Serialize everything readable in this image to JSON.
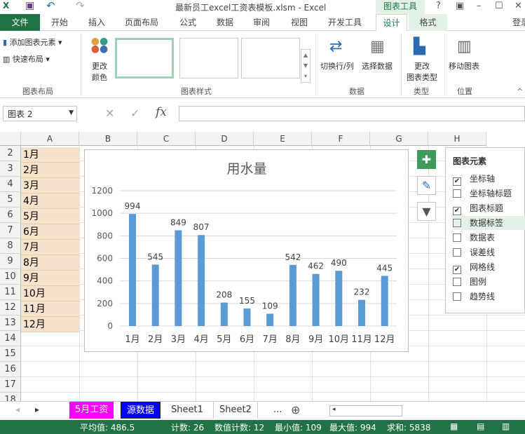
{
  "titlebar": {
    "title": "最新员工excel工资表模板.xlsm - Excel",
    "context_tab": "图表工具",
    "help": "?"
  },
  "tabs": [
    "文件",
    "开始",
    "插入",
    "页面布局",
    "公式",
    "数据",
    "审阅",
    "视图",
    "开发工具",
    "设计",
    "格式"
  ],
  "login": "登录",
  "ribbon": {
    "add_element": "添加图表元素",
    "quick_layout": "快速布局",
    "change_color_1": "更改",
    "change_color_2": "颜色",
    "switch_rowcol": "切换行/列",
    "select_data": "选择数据",
    "change_type_1": "更改",
    "change_type_2": "图表类型",
    "move_chart": "移动图表",
    "groups": [
      "图表布局",
      "图表样式",
      "数据",
      "类型",
      "位置"
    ]
  },
  "formula_bar": {
    "name_box": "图表 2",
    "fx": "fx",
    "value": ""
  },
  "columns": [
    "A",
    "B",
    "C",
    "D",
    "E",
    "F",
    "G",
    "H"
  ],
  "rows": [
    "2",
    "3",
    "4",
    "5",
    "6",
    "7",
    "8",
    "9",
    "10",
    "11",
    "12",
    "13",
    "14",
    "15",
    "16",
    "17",
    "18"
  ],
  "cells_A": [
    "1月",
    "2月",
    "3月",
    "4月",
    "5月",
    "6月",
    "7月",
    "8月",
    "9月",
    "10月",
    "11月",
    "12月"
  ],
  "chart_data": {
    "type": "bar",
    "title": "用水量",
    "categories": [
      "1月",
      "2月",
      "3月",
      "4月",
      "5月",
      "6月",
      "7月",
      "8月",
      "9月",
      "10月",
      "11月",
      "12月"
    ],
    "values": [
      994,
      545,
      849,
      807,
      208,
      155,
      109,
      542,
      462,
      490,
      232,
      445
    ],
    "yticks": [
      "0",
      "200",
      "400",
      "600",
      "800",
      "1000",
      "1200"
    ],
    "ylim": [
      0,
      1200
    ],
    "grid": true,
    "color": "#5b9bd5"
  },
  "chart_elements": {
    "header": "图表元素",
    "items": [
      {
        "label": "坐标轴",
        "checked": true
      },
      {
        "label": "坐标轴标题",
        "checked": false
      },
      {
        "label": "图表标题",
        "checked": true
      },
      {
        "label": "数据标签",
        "checked": false
      },
      {
        "label": "数据表",
        "checked": false
      },
      {
        "label": "误差线",
        "checked": false
      },
      {
        "label": "网格线",
        "checked": true
      },
      {
        "label": "图例",
        "checked": false
      },
      {
        "label": "趋势线",
        "checked": false
      }
    ]
  },
  "sheets": [
    {
      "name": "5月工资",
      "bg": "#ff00ff",
      "fg": "#ffffff"
    },
    {
      "name": "源数据",
      "bg": "#0000ff",
      "fg": "#ffffff"
    },
    {
      "name": "Sheet1"
    },
    {
      "name": "Sheet2"
    }
  ],
  "sheets_more": "...",
  "status": {
    "avg": "平均值: 486.5",
    "count": "计数: 26",
    "numcount": "数值计数: 12",
    "min": "最小值: 109",
    "max": "最大值: 994",
    "sum": "求和: 5838"
  }
}
